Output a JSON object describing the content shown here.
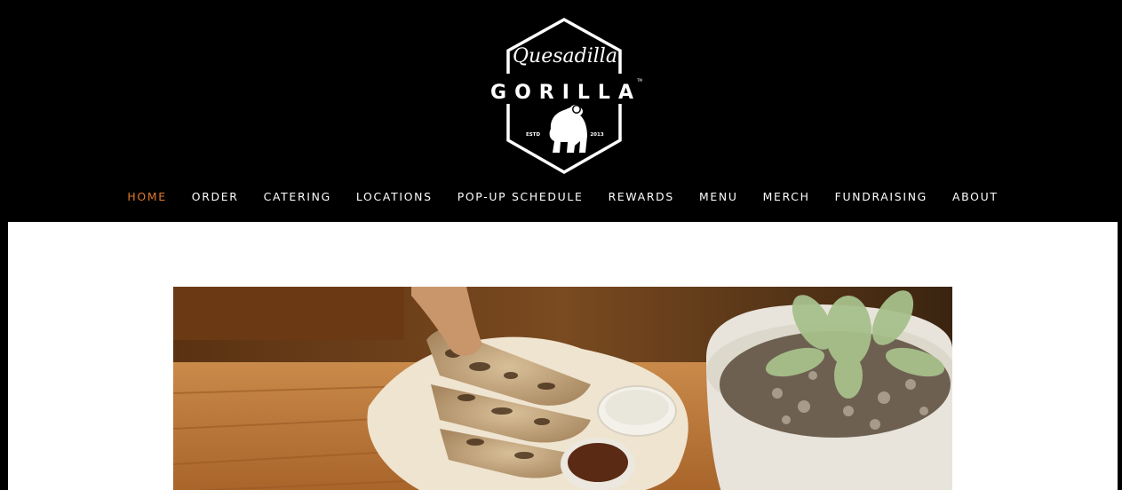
{
  "logo": {
    "script_text": "Quesadilla",
    "word_text": "GORILLA",
    "tm_text": "TM",
    "estd_label": "ESTD",
    "year_label": "2013",
    "icon": "gorilla-icon"
  },
  "nav": {
    "items": [
      {
        "label": "HOME",
        "active": true
      },
      {
        "label": "ORDER"
      },
      {
        "label": "CATERING"
      },
      {
        "label": "LOCATIONS"
      },
      {
        "label": "POP-UP SCHEDULE"
      },
      {
        "label": "REWARDS"
      },
      {
        "label": "MENU"
      },
      {
        "label": "MERCH"
      },
      {
        "label": "FUNDRAISING"
      },
      {
        "label": "ABOUT"
      }
    ]
  },
  "colors": {
    "header_bg": "#000000",
    "page_bg": "#ffffff",
    "nav_active": "#e2782a",
    "nav_text": "#ffffff"
  }
}
